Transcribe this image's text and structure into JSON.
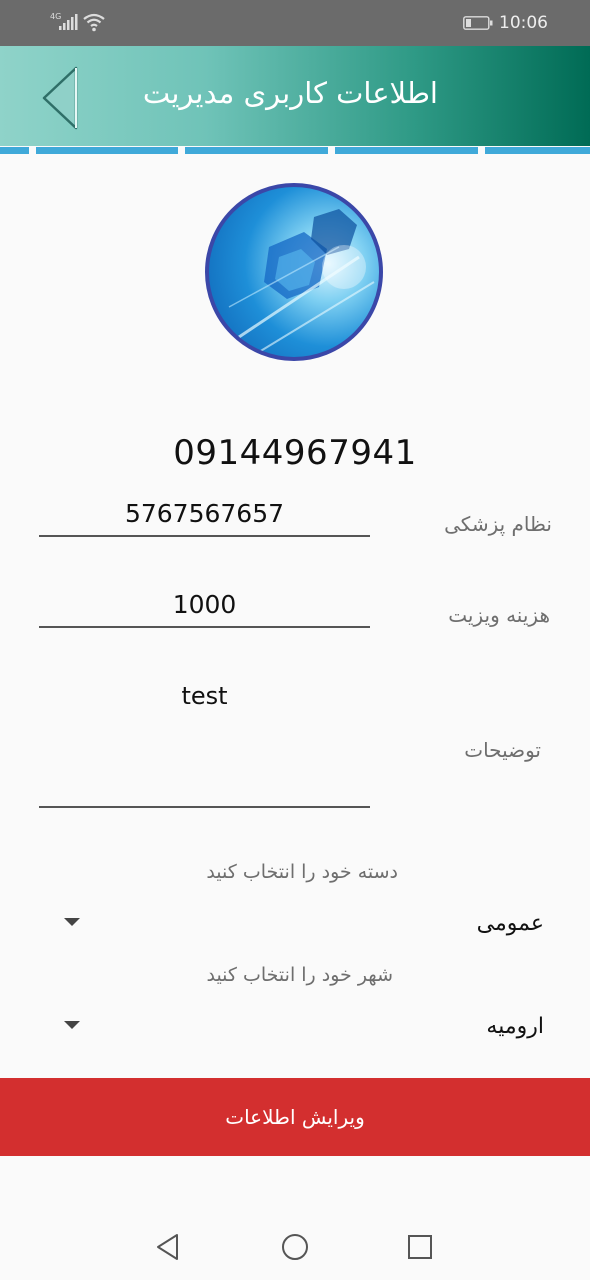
{
  "status_bar": {
    "network": "4G",
    "time": "10:06",
    "icons": [
      "signal-icon",
      "wifi-icon",
      "battery-icon"
    ]
  },
  "app_bar": {
    "title": "اطلاعات کاربری مدیریت",
    "back_icon": "back-arrow-icon",
    "gradient": [
      "#8fd3c9",
      "#006b55"
    ]
  },
  "profile": {
    "avatar": "profile-avatar",
    "phone": "09144967941"
  },
  "form": {
    "medical_council": {
      "label": "نظام پزشکی",
      "value": "5767567657"
    },
    "visit_fee": {
      "label": "هزینه ویزیت",
      "value": "1000"
    },
    "description": {
      "label": "توضیحات",
      "value": "test"
    },
    "category": {
      "hint": "دسته خود را انتخاب کنید",
      "selected": "عمومی"
    },
    "city": {
      "hint": "شهر خود را انتخاب کنید",
      "selected": "ارومیه"
    }
  },
  "actions": {
    "edit_label": "ویرایش اطلاعات",
    "edit_color": "#d32f2f"
  },
  "nav_bar": {
    "icons": [
      "nav-back-icon",
      "nav-home-icon",
      "nav-recents-icon"
    ]
  }
}
